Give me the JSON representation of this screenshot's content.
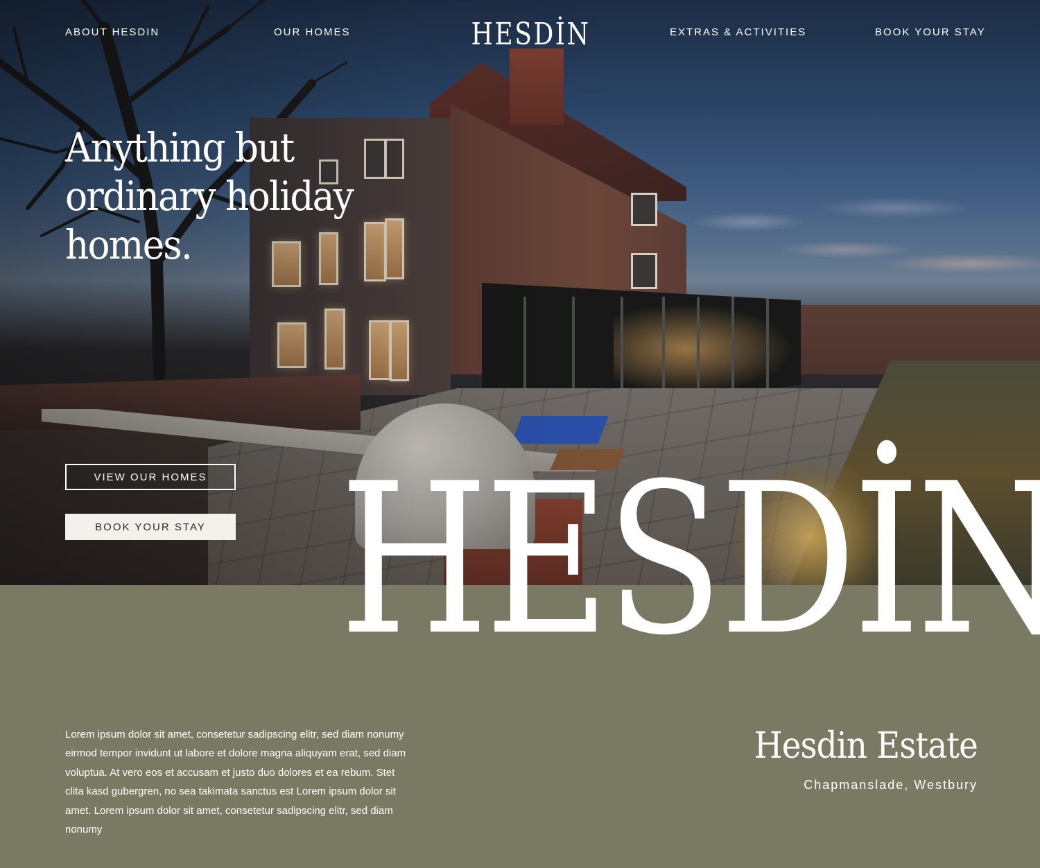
{
  "nav": {
    "left_links": [
      "ABOUT HESDIN",
      "OUR HOMES"
    ],
    "logo": "HESDİN",
    "right_links": [
      "EXTRAS & ACTIVITIES",
      "BOOK YOUR STAY"
    ]
  },
  "hero": {
    "headline": "Anything but ordinary holiday homes.",
    "primary_button": "VIEW OUR HOMES",
    "secondary_button": "BOOK YOUR STAY",
    "wordmark": "HESDİN"
  },
  "intro": {
    "body": "Lorem ipsum dolor sit amet, consetetur sadipscing elitr, sed diam nonumy eirmod tempor invidunt ut labore et dolore magna aliquyam erat, sed diam voluptua. At vero eos et accusam et justo duo dolores et ea rebum. Stet clita kasd gubergren, no sea takimata sanctus est Lorem ipsum dolor sit amet. Lorem ipsum dolor sit amet, consetetur sadipscing elitr, sed diam nonumy",
    "estate_name": "Hesdin Estate",
    "estate_location": "Chapmanslade, Westbury"
  },
  "colors": {
    "olive_section": "#7a7a64",
    "button_solid": "#f4f1ec",
    "text_light": "#ffffff"
  }
}
